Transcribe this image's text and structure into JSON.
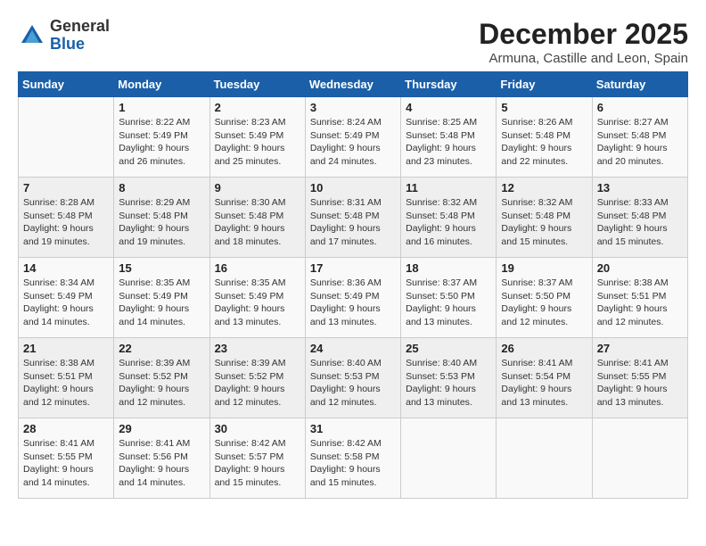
{
  "header": {
    "title": "December 2025",
    "location": "Armuna, Castille and Leon, Spain",
    "logo_line1": "General",
    "logo_line2": "Blue"
  },
  "weekdays": [
    "Sunday",
    "Monday",
    "Tuesday",
    "Wednesday",
    "Thursday",
    "Friday",
    "Saturday"
  ],
  "weeks": [
    [
      {
        "day": "",
        "info": ""
      },
      {
        "day": "1",
        "info": "Sunrise: 8:22 AM\nSunset: 5:49 PM\nDaylight: 9 hours\nand 26 minutes."
      },
      {
        "day": "2",
        "info": "Sunrise: 8:23 AM\nSunset: 5:49 PM\nDaylight: 9 hours\nand 25 minutes."
      },
      {
        "day": "3",
        "info": "Sunrise: 8:24 AM\nSunset: 5:49 PM\nDaylight: 9 hours\nand 24 minutes."
      },
      {
        "day": "4",
        "info": "Sunrise: 8:25 AM\nSunset: 5:48 PM\nDaylight: 9 hours\nand 23 minutes."
      },
      {
        "day": "5",
        "info": "Sunrise: 8:26 AM\nSunset: 5:48 PM\nDaylight: 9 hours\nand 22 minutes."
      },
      {
        "day": "6",
        "info": "Sunrise: 8:27 AM\nSunset: 5:48 PM\nDaylight: 9 hours\nand 20 minutes."
      }
    ],
    [
      {
        "day": "7",
        "info": "Sunrise: 8:28 AM\nSunset: 5:48 PM\nDaylight: 9 hours\nand 19 minutes."
      },
      {
        "day": "8",
        "info": "Sunrise: 8:29 AM\nSunset: 5:48 PM\nDaylight: 9 hours\nand 19 minutes."
      },
      {
        "day": "9",
        "info": "Sunrise: 8:30 AM\nSunset: 5:48 PM\nDaylight: 9 hours\nand 18 minutes."
      },
      {
        "day": "10",
        "info": "Sunrise: 8:31 AM\nSunset: 5:48 PM\nDaylight: 9 hours\nand 17 minutes."
      },
      {
        "day": "11",
        "info": "Sunrise: 8:32 AM\nSunset: 5:48 PM\nDaylight: 9 hours\nand 16 minutes."
      },
      {
        "day": "12",
        "info": "Sunrise: 8:32 AM\nSunset: 5:48 PM\nDaylight: 9 hours\nand 15 minutes."
      },
      {
        "day": "13",
        "info": "Sunrise: 8:33 AM\nSunset: 5:48 PM\nDaylight: 9 hours\nand 15 minutes."
      }
    ],
    [
      {
        "day": "14",
        "info": "Sunrise: 8:34 AM\nSunset: 5:49 PM\nDaylight: 9 hours\nand 14 minutes."
      },
      {
        "day": "15",
        "info": "Sunrise: 8:35 AM\nSunset: 5:49 PM\nDaylight: 9 hours\nand 14 minutes."
      },
      {
        "day": "16",
        "info": "Sunrise: 8:35 AM\nSunset: 5:49 PM\nDaylight: 9 hours\nand 13 minutes."
      },
      {
        "day": "17",
        "info": "Sunrise: 8:36 AM\nSunset: 5:49 PM\nDaylight: 9 hours\nand 13 minutes."
      },
      {
        "day": "18",
        "info": "Sunrise: 8:37 AM\nSunset: 5:50 PM\nDaylight: 9 hours\nand 13 minutes."
      },
      {
        "day": "19",
        "info": "Sunrise: 8:37 AM\nSunset: 5:50 PM\nDaylight: 9 hours\nand 12 minutes."
      },
      {
        "day": "20",
        "info": "Sunrise: 8:38 AM\nSunset: 5:51 PM\nDaylight: 9 hours\nand 12 minutes."
      }
    ],
    [
      {
        "day": "21",
        "info": "Sunrise: 8:38 AM\nSunset: 5:51 PM\nDaylight: 9 hours\nand 12 minutes."
      },
      {
        "day": "22",
        "info": "Sunrise: 8:39 AM\nSunset: 5:52 PM\nDaylight: 9 hours\nand 12 minutes."
      },
      {
        "day": "23",
        "info": "Sunrise: 8:39 AM\nSunset: 5:52 PM\nDaylight: 9 hours\nand 12 minutes."
      },
      {
        "day": "24",
        "info": "Sunrise: 8:40 AM\nSunset: 5:53 PM\nDaylight: 9 hours\nand 12 minutes."
      },
      {
        "day": "25",
        "info": "Sunrise: 8:40 AM\nSunset: 5:53 PM\nDaylight: 9 hours\nand 13 minutes."
      },
      {
        "day": "26",
        "info": "Sunrise: 8:41 AM\nSunset: 5:54 PM\nDaylight: 9 hours\nand 13 minutes."
      },
      {
        "day": "27",
        "info": "Sunrise: 8:41 AM\nSunset: 5:55 PM\nDaylight: 9 hours\nand 13 minutes."
      }
    ],
    [
      {
        "day": "28",
        "info": "Sunrise: 8:41 AM\nSunset: 5:55 PM\nDaylight: 9 hours\nand 14 minutes."
      },
      {
        "day": "29",
        "info": "Sunrise: 8:41 AM\nSunset: 5:56 PM\nDaylight: 9 hours\nand 14 minutes."
      },
      {
        "day": "30",
        "info": "Sunrise: 8:42 AM\nSunset: 5:57 PM\nDaylight: 9 hours\nand 15 minutes."
      },
      {
        "day": "31",
        "info": "Sunrise: 8:42 AM\nSunset: 5:58 PM\nDaylight: 9 hours\nand 15 minutes."
      },
      {
        "day": "",
        "info": ""
      },
      {
        "day": "",
        "info": ""
      },
      {
        "day": "",
        "info": ""
      }
    ]
  ]
}
